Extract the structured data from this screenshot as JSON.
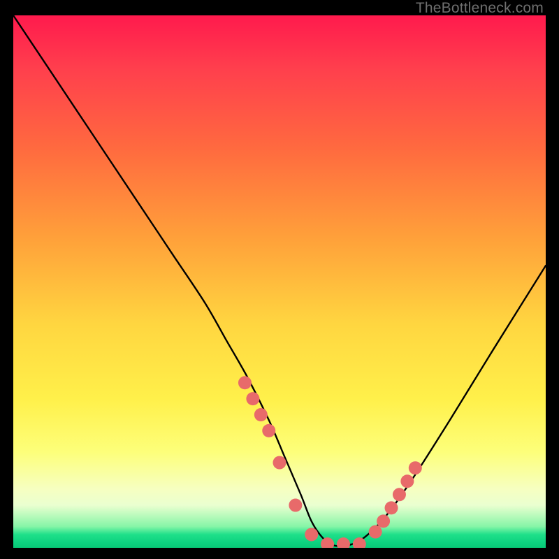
{
  "watermark": "TheBottleneck.com",
  "chart_data": {
    "type": "line",
    "title": "",
    "xlabel": "",
    "ylabel": "",
    "xlim": [
      0,
      100
    ],
    "ylim": [
      0,
      100
    ],
    "series": [
      {
        "name": "bottleneck-curve",
        "x": [
          0,
          6,
          12,
          18,
          24,
          30,
          36,
          40,
          44,
          48,
          51,
          54,
          56,
          58,
          60,
          63,
          66,
          70,
          75,
          82,
          90,
          100
        ],
        "values": [
          100,
          91,
          82,
          73,
          64,
          55,
          46,
          39,
          32,
          24,
          17,
          10,
          5,
          2,
          0.5,
          0.5,
          2,
          6,
          13,
          24,
          37,
          53
        ]
      },
      {
        "name": "marker-dots",
        "x": [
          43.5,
          45.0,
          46.5,
          48.0,
          50.0,
          53.0,
          56.0,
          59.0,
          62.0,
          65.0,
          68.0,
          69.5,
          71.0,
          72.5,
          74.0,
          75.5
        ],
        "values": [
          31.0,
          28.0,
          25.0,
          22.0,
          16.0,
          8.0,
          2.5,
          0.7,
          0.7,
          0.7,
          3.0,
          5.0,
          7.5,
          10.0,
          12.5,
          15.0
        ]
      }
    ],
    "gradient_stops": [
      {
        "pos": 0,
        "color": "#ff1a4d"
      },
      {
        "pos": 0.42,
        "color": "#ffa13a"
      },
      {
        "pos": 0.72,
        "color": "#fff04a"
      },
      {
        "pos": 0.96,
        "color": "#86f5a7"
      },
      {
        "pos": 1.0,
        "color": "#08c977"
      }
    ]
  }
}
